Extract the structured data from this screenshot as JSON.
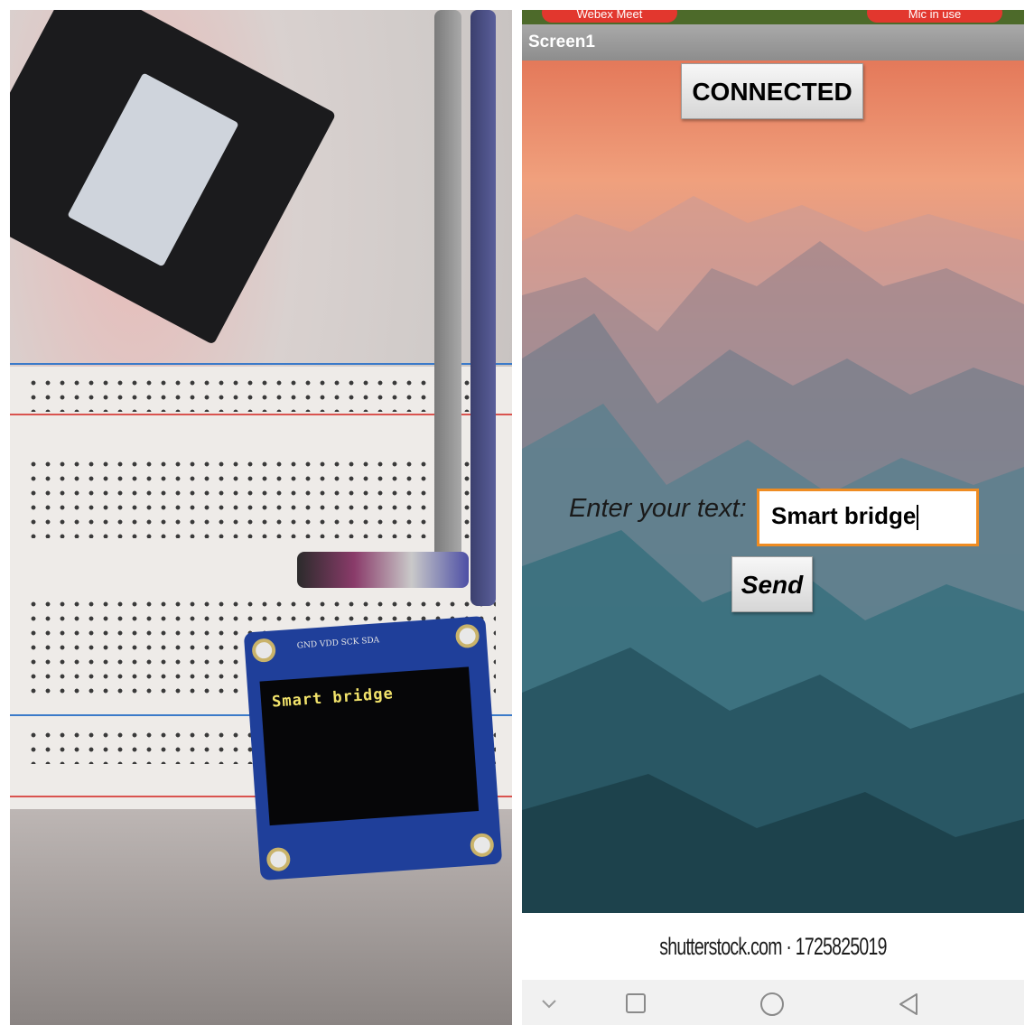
{
  "notification_bar": {
    "left_pill": "Webex Meet",
    "right_pill": "Mic in use"
  },
  "app": {
    "screen_title": "Screen1",
    "connection_button": "CONNECTED",
    "input_label": "Enter your text:",
    "input_value": "Smart bridge",
    "send_button": "Send",
    "background_watermark": "shutterstock.com · 1725825019"
  },
  "photo": {
    "oled_display_text": "Smart bridge",
    "oled_pin_labels": "GND VDD SCK SDA"
  },
  "navigation": {
    "icons": [
      "chevron-down-icon",
      "recents-square-icon",
      "home-circle-icon",
      "back-triangle-icon"
    ]
  },
  "colors": {
    "textbox_focus_border": "#ef8c22",
    "notification_pill": "#e2372e",
    "title_bar": "#9b9b9b"
  }
}
